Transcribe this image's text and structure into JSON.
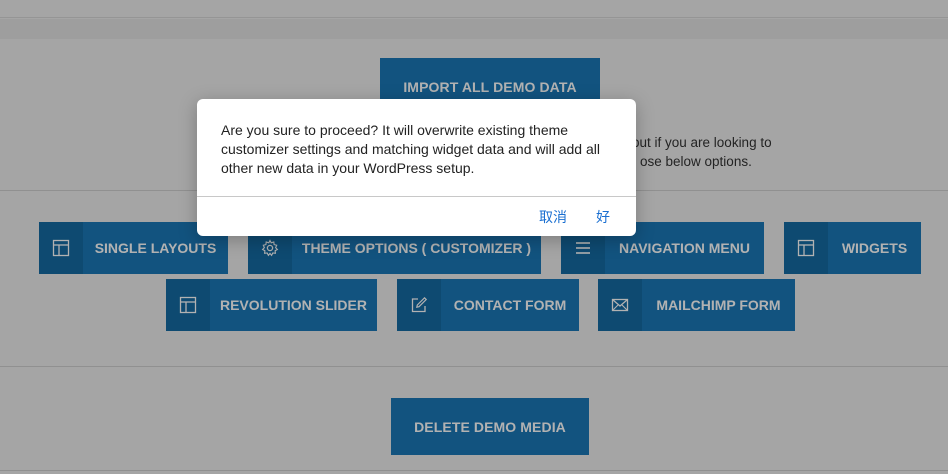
{
  "actions": {
    "import_all_label": "IMPORT ALL DEMO DATA",
    "delete_media_label": "DELETE DEMO MEDIA"
  },
  "intro_text": {
    "line1": "out if you are looking to",
    "line2": "ose below options."
  },
  "tiles": [
    {
      "label": "SINGLE LAYOUTS",
      "icon": "layout-icon"
    },
    {
      "label": "THEME OPTIONS ( CUSTOMIZER )",
      "icon": "gear-icon"
    },
    {
      "label": "NAVIGATION MENU",
      "icon": "menu-icon"
    },
    {
      "label": "WIDGETS",
      "icon": "layout-icon"
    },
    {
      "label": "REVOLUTION SLIDER",
      "icon": "layout-icon"
    },
    {
      "label": "CONTACT FORM",
      "icon": "edit-icon"
    },
    {
      "label": "MAILCHIMP FORM",
      "icon": "envelope-icon"
    }
  ],
  "dialog": {
    "message": "Are you sure to proceed? It will overwrite existing theme customizer settings and matching widget data and will add all other new data in your WordPress setup.",
    "cancel_label": "取消",
    "ok_label": "好"
  },
  "colors": {
    "accent": "#1a78b7",
    "icon_block": "#156aa3",
    "dialog_button": "#1a6fd1"
  }
}
